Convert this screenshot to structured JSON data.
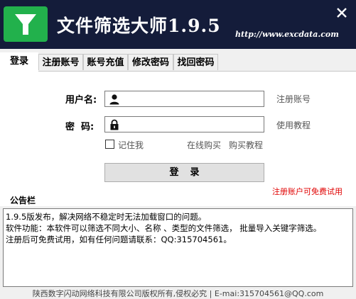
{
  "window": {
    "title": "文件筛选大师1.9.5",
    "url": "http://www.excdata.com"
  },
  "tabs": [
    {
      "label": "登录",
      "active": true
    },
    {
      "label": "注册账号",
      "active": false
    },
    {
      "label": "账号充值",
      "active": false
    },
    {
      "label": "修改密码",
      "active": false
    },
    {
      "label": "找回密码",
      "active": false
    }
  ],
  "login": {
    "username_label": "用户名:",
    "username_value": "",
    "password_label": "密  码:",
    "password_value": "",
    "register_link": "注册账号",
    "tutorial_link": "使用教程",
    "remember_label": "记住我",
    "remember_checked": false,
    "online_buy_link": "在线购买",
    "buy_tutorial_link": "购买教程",
    "login_button": "登录",
    "promo": "注册账户可免费试用"
  },
  "notice": {
    "title": "公告栏",
    "lines": [
      "1.9.5版发布，解决网络不稳定时无法加载窗口的问题。",
      "软件功能：本软件可以筛选不同大小、名称 、类型的文件筛选， 批量导入关键字筛选。",
      "注册后可免费试用，如有任何问题请联系：QQ:315704561。"
    ]
  },
  "footer": "陕西数字闪动网络科技有限公司版权所有,侵权必究 | E-mai:315704561@QQ.com",
  "colors": {
    "titlebar": "#141c3a",
    "logo": "#22b14c",
    "promo": "#e00000"
  },
  "icons": {
    "logo": "funnel-icon",
    "close": "close-icon",
    "user": "user-icon",
    "lock": "lock-icon"
  }
}
